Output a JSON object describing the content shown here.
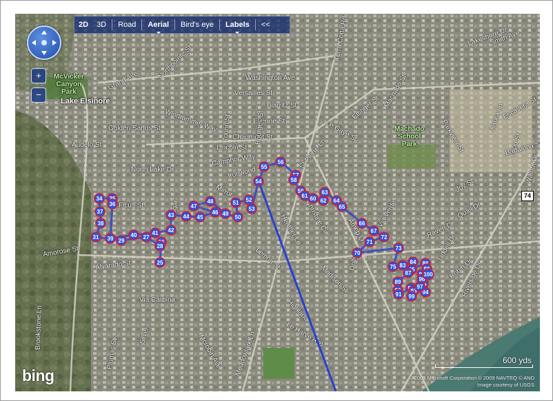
{
  "toolbar": {
    "items": [
      {
        "label": "2D",
        "active": true
      },
      {
        "label": "3D",
        "active": false
      },
      {
        "label": "Road",
        "active": false
      },
      {
        "label": "Aerial",
        "active": true
      },
      {
        "label": "Bird's eye",
        "active": false
      },
      {
        "label": "Labels",
        "active": true
      },
      {
        "label": "<<",
        "active": false
      }
    ]
  },
  "zoom": {
    "in": "+",
    "out": "−"
  },
  "areas": {
    "park": "McVicker Canyon Park",
    "park_line1": "McVicker",
    "park_line2": "Canyon",
    "park_line3": "Park",
    "city": "Lake Elsinore",
    "school_line1": "Machado",
    "school_line2": "School",
    "school_line3": "Park"
  },
  "highway_shield": "74",
  "streets": [
    "Grand Ave",
    "Lakeshore Dr",
    "Smith Ave",
    "Washington Ave",
    "Versailles St",
    "Biarritz St",
    "Etienne St",
    "Chaumont St",
    "Lincoln St",
    "Camphor Way",
    "Ironwood St",
    "Golden Sands St",
    "Audelo St",
    "North Lake Dr",
    "Ficus St",
    "Sugar",
    "Amorose St",
    "Alvarado St",
    "Lemon St",
    "Mirror",
    "Heather Ln",
    "Christine Cir",
    "Machado St",
    "Riverside Dr",
    "Via Verde",
    "Joy St",
    "Quail Dr",
    "Raven Dr",
    "Robin Dr",
    "Via Carbina",
    "Madison St",
    "Highland",
    "Le Harve Ave",
    "Brookstone Ln",
    "Plumas St",
    "Mcrobin Ave",
    "Meadowlark Ln",
    "Walnut Dr",
    "Ameb Ln",
    "Ettinger St",
    "Leon St",
    "Parkview St",
    "Escavera St",
    "Jerora Ln",
    "Badalona St",
    "Le Gaye St",
    "St Pierre Ln",
    "Terra Cotta Rd",
    "Windrammer Way",
    "Northpointe St",
    "Tourin St",
    "Bourges St",
    "Dolly Dr",
    "Lindell Dr",
    "Silver"
  ],
  "route_markers": [
    25,
    26,
    27,
    28,
    29,
    31,
    34,
    35,
    36,
    37,
    38,
    39,
    40,
    41,
    42,
    43,
    44,
    45,
    46,
    47,
    48,
    49,
    50,
    51,
    52,
    53,
    54,
    55,
    56,
    57,
    58,
    59,
    60,
    61,
    62,
    63,
    64,
    65,
    66,
    67,
    70,
    71,
    72,
    73,
    75,
    83,
    84,
    85,
    86,
    87,
    88,
    89,
    90,
    91,
    92,
    93,
    94,
    95,
    96,
    97,
    98,
    99,
    100
  ],
  "scale": {
    "label": "600 yds"
  },
  "copyright": {
    "line1": "© 2009 Microsoft Corporation   © 2009 NAVTEQ   © AND",
    "line2": "Image courtesy of USGS"
  },
  "logo": "bing"
}
